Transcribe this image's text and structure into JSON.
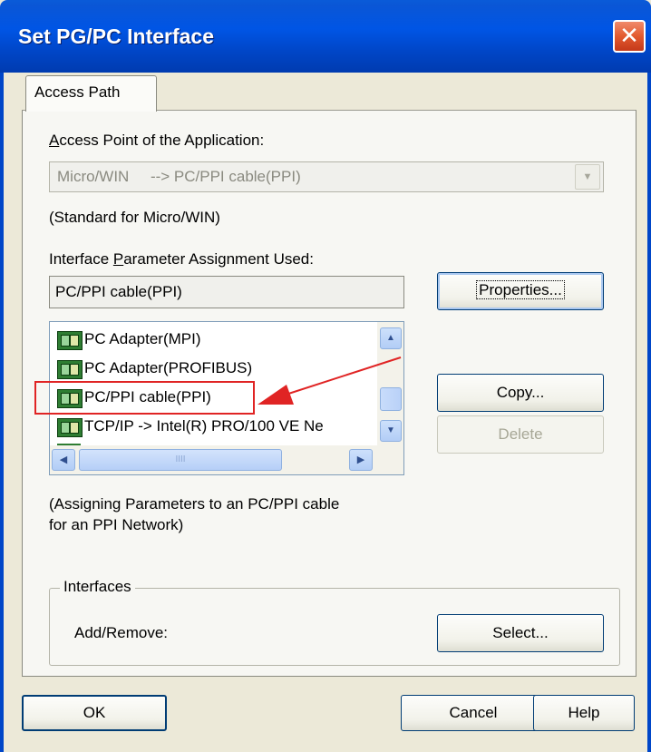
{
  "window": {
    "title": "Set PG/PC Interface",
    "close_glyph": "✕"
  },
  "tab": {
    "label": "Access Path"
  },
  "access_point": {
    "label_prefix": "A",
    "label_rest": "ccess Point of the Application:",
    "value": "Micro/WIN     --> PC/PPI cable(PPI)",
    "arrow_glyph": "▼",
    "note": "(Standard for Micro/WIN)"
  },
  "param_assignment": {
    "label_before": "Interface ",
    "label_key": "P",
    "label_after": "arameter Assignment Used:",
    "value": "PC/PPI cable(PPI)"
  },
  "interface_list": {
    "items": [
      {
        "label": "PC Adapter(MPI)",
        "icon": "network-card-icon"
      },
      {
        "label": "PC Adapter(PROFIBUS)",
        "icon": "network-card-icon"
      },
      {
        "label": "PC/PPI cable(PPI)",
        "icon": "network-card-icon"
      },
      {
        "label": "TCP/IP -> Intel(R) PRO/100 VE Ne",
        "icon": "network-card-icon"
      }
    ],
    "scroll_up_glyph": "▲",
    "scroll_down_glyph": "▼",
    "scroll_left_glyph": "◀",
    "scroll_right_glyph": "▶",
    "thumb_grip": "IIII"
  },
  "buttons": {
    "properties": "Properties...",
    "copy": "Copy...",
    "delete": "Delete",
    "select": "Select...",
    "ok": "OK",
    "cancel": "Cancel",
    "help": "Help"
  },
  "description": {
    "line1": "(Assigning Parameters to an PC/PPI cable",
    "line2": "for an PPI Network)"
  },
  "interfaces_group": {
    "title": "Interfaces",
    "add_remove_label": "Add/Remove:"
  },
  "colors": {
    "annotation": "#e02424",
    "title_bar": "#0055e5",
    "dialog_face": "#ece9d8"
  }
}
